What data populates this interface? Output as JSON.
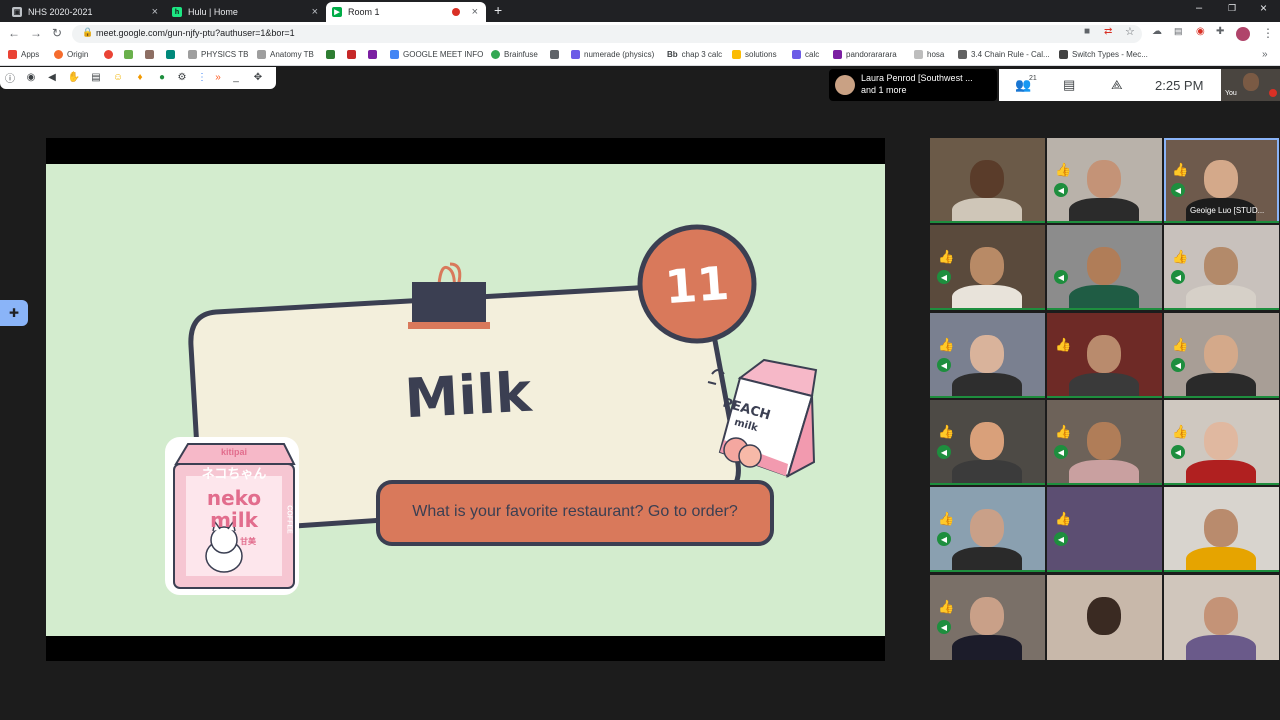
{
  "browser": {
    "tabs": [
      {
        "label": "NHS 2020-2021",
        "icon": "document-icon"
      },
      {
        "label": "Hulu | Home",
        "icon": "hulu-icon"
      },
      {
        "label": "Room 1",
        "icon": "meet-icon",
        "active": true
      }
    ],
    "new_tab_symbol": "+",
    "url": "meet.google.com/gun-njfy-ptu?authuser=1&bor=1"
  },
  "bookmarks": [
    {
      "label": "Apps",
      "color": "#ea4335"
    },
    {
      "label": "Origin",
      "color": "#f56c2d"
    },
    {
      "label": "",
      "color": "#ea4335"
    },
    {
      "label": "",
      "color": "#6ab04c"
    },
    {
      "label": "",
      "color": "#8d6e63"
    },
    {
      "label": "",
      "color": "#00897b"
    },
    {
      "label": "PHYSICS TB",
      "color": "#9e9e9e"
    },
    {
      "label": "Anatomy TB",
      "color": "#9e9e9e"
    },
    {
      "label": "",
      "color": "#2e7d32"
    },
    {
      "label": "",
      "color": "#c62828"
    },
    {
      "label": "",
      "color": "#7b1fa2"
    },
    {
      "label": "GOOGLE MEET INFO",
      "color": "#4285f4"
    },
    {
      "label": "Brainfuse",
      "color": "#34a853"
    },
    {
      "label": "",
      "color": "#5f6368"
    },
    {
      "label": "numerade (physics)",
      "color": "#6c5ce7"
    },
    {
      "label": "chap 3 calc",
      "color": "#202124",
      "prefix": "Bb"
    },
    {
      "label": "solutions",
      "color": "#fbbc05"
    },
    {
      "label": "calc",
      "color": "#6c5ce7"
    },
    {
      "label": "pandorararara",
      "color": "#7b1fa2"
    },
    {
      "label": "hosa",
      "color": "#bdbdbd"
    },
    {
      "label": "3.4 Chain Rule - Cal...",
      "color": "#616161"
    },
    {
      "label": "Switch Types - Mec...",
      "color": "#424242"
    }
  ],
  "meet": {
    "presenter_line1": "Laura Penrod [Southwest ...",
    "presenter_line2": "and 1 more",
    "participant_count": "21",
    "time": "2:25 PM",
    "self_label": "You"
  },
  "slide": {
    "number": "11",
    "title": "Milk",
    "question": "What is your favorite restaurant? Go to order?",
    "left_carton": {
      "brand": "kitipai",
      "kana": "ネコちゃん",
      "line1": "neko",
      "line2": "milk",
      "side": "COFFEE",
      "tag": "甘美"
    },
    "right_carton": {
      "line1": "PEACH",
      "line2": "milk"
    }
  },
  "participants": [
    {
      "name": "",
      "thumb": false,
      "mic": false,
      "bg": "#6b5a48",
      "skin": "#5a3c2a",
      "shirt": "#cfc6b8"
    },
    {
      "name": "",
      "thumb": true,
      "mic": true,
      "bg": "#b9b2aa",
      "skin": "#c49377",
      "shirt": "#2b2b2b"
    },
    {
      "name": "Geoige Luo [STUD...",
      "thumb": true,
      "mic": true,
      "bg": "#6e5a4c",
      "skin": "#d4a98a",
      "shirt": "#1c1c1c",
      "speaking": true
    },
    {
      "name": "",
      "thumb": true,
      "mic": true,
      "bg": "#5a4a3c",
      "skin": "#b88a66",
      "shirt": "#e8e3da"
    },
    {
      "name": "",
      "thumb": false,
      "mic": true,
      "bg": "#8c8c8c",
      "skin": "#b07d58",
      "shirt": "#1f5c44"
    },
    {
      "name": "",
      "thumb": true,
      "mic": true,
      "bg": "#c8c1bc",
      "skin": "#b38a6a",
      "shirt": "#d6d0c8"
    },
    {
      "name": "",
      "thumb": true,
      "mic": true,
      "bg": "#7a8090",
      "skin": "#d9b39b",
      "shirt": "#2e2e2e"
    },
    {
      "name": "",
      "thumb": true,
      "mic": false,
      "bg": "#6e2a26",
      "skin": "#b98b6d",
      "shirt": "#3a3a3a"
    },
    {
      "name": "",
      "thumb": true,
      "mic": true,
      "bg": "#a89e96",
      "skin": "#d4a98a",
      "shirt": "#2a2a2a"
    },
    {
      "name": "",
      "thumb": true,
      "mic": true,
      "bg": "#4d4a45",
      "skin": "#d9a07a",
      "shirt": "#3b3b3b"
    },
    {
      "name": "",
      "thumb": true,
      "mic": true,
      "bg": "#6d6259",
      "skin": "#b07d58",
      "shirt": "#c9a0a0"
    },
    {
      "name": "",
      "thumb": true,
      "mic": true,
      "bg": "#cfc8c0",
      "skin": "#e0b8a0",
      "shirt": "#b02020"
    },
    {
      "name": "",
      "thumb": true,
      "mic": true,
      "bg": "#8aa0b0",
      "skin": "#c9a088",
      "shirt": "#2a2a2a"
    },
    {
      "name": "",
      "thumb": true,
      "mic": true,
      "bg": "#5c4e72",
      "skin": "#5c4e72",
      "shirt": "#5c4e72"
    },
    {
      "name": "",
      "thumb": false,
      "mic": false,
      "bg": "#d8d4ce",
      "skin": "#b98b6d",
      "shirt": "#e6a400"
    },
    {
      "name": "",
      "thumb": true,
      "mic": true,
      "bg": "#7a7068",
      "skin": "#c9a088",
      "shirt": "#1c1c2a"
    },
    {
      "name": "",
      "thumb": false,
      "mic": false,
      "bg": "#c8b8aa",
      "skin": "#3a2a22",
      "shirt": "#c8b8aa"
    },
    {
      "name": "",
      "thumb": false,
      "mic": false,
      "bg": "#d0c6bc",
      "skin": "#c49377",
      "shirt": "#6a5a8a"
    }
  ],
  "colors": {
    "slide_bg": "#d3ecce",
    "card_bg": "#f3efdc",
    "outline": "#3b3f52",
    "accent": "#d9795b",
    "title": "#3b3f52",
    "mic_green": "#1e8e3e"
  }
}
